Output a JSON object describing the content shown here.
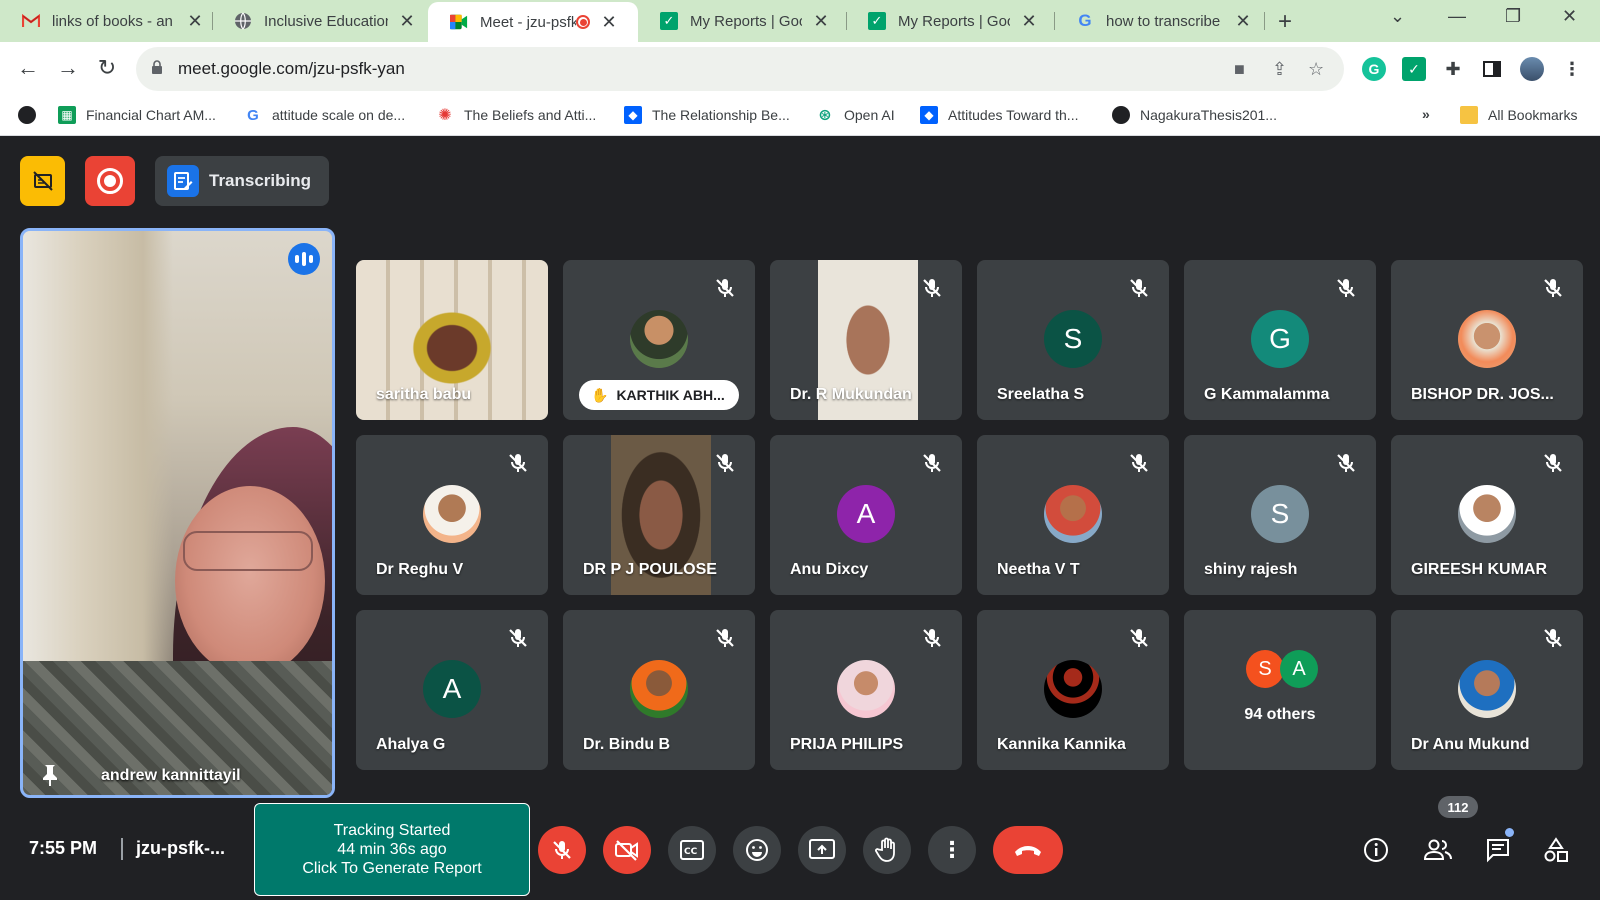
{
  "browser": {
    "tabs": [
      {
        "title": "links of books - an",
        "icon": "gmail-icon"
      },
      {
        "title": "Inclusive Education",
        "icon": "globe-icon"
      },
      {
        "title": "Meet - jzu-psfk",
        "icon": "meet-icon",
        "recording": true
      },
      {
        "title": "My Reports | Goog",
        "icon": "check-icon"
      },
      {
        "title": "My Reports | Goog",
        "icon": "check-icon"
      },
      {
        "title": "how to transcribe t",
        "icon": "google-icon"
      }
    ],
    "url": "meet.google.com/jzu-psfk-yan",
    "bookmarks": [
      {
        "label": "Financial Chart AM...",
        "icon": "sheets-icon"
      },
      {
        "label": "attitude scale on de...",
        "icon": "google-icon"
      },
      {
        "label": "The Beliefs and Atti...",
        "icon": "flower-icon"
      },
      {
        "label": "The Relationship Be...",
        "icon": "dropbox-icon"
      },
      {
        "label": "Open AI",
        "icon": "openai-icon"
      },
      {
        "label": "Attitudes Toward th...",
        "icon": "dropbox-icon"
      },
      {
        "label": "NagakuraThesis201...",
        "icon": "globe-icon"
      }
    ],
    "overflow": "»",
    "all_bookmarks": "All Bookmarks"
  },
  "meet": {
    "transcribing_label": "Transcribing",
    "speaker": {
      "name": "andrew kannittayil"
    },
    "tiles": [
      {
        "name": "saritha babu",
        "kind": "video",
        "muted": false
      },
      {
        "name": "KARTHIK ABH...",
        "kind": "photo",
        "muted": true,
        "hand_raised": true
      },
      {
        "name": "Dr. R Mukundan",
        "kind": "video",
        "muted": true
      },
      {
        "name": "Sreelatha S",
        "kind": "letter",
        "letter": "S",
        "color": "#0b5345",
        "muted": true
      },
      {
        "name": "G Kammalamma",
        "kind": "letter",
        "letter": "G",
        "color": "#138a7a",
        "muted": true
      },
      {
        "name": "BISHOP DR. JOS...",
        "kind": "photo",
        "muted": true
      },
      {
        "name": "Dr Reghu V",
        "kind": "photo",
        "muted": true
      },
      {
        "name": "DR P J POULOSE",
        "kind": "video",
        "muted": true
      },
      {
        "name": "Anu Dixcy",
        "kind": "letter",
        "letter": "A",
        "color": "#8e24aa",
        "muted": true
      },
      {
        "name": "Neetha V T",
        "kind": "photo",
        "muted": true
      },
      {
        "name": "shiny rajesh",
        "kind": "letter",
        "letter": "S",
        "color": "#78909c",
        "muted": true
      },
      {
        "name": "GIREESH KUMAR",
        "kind": "photo",
        "muted": true
      },
      {
        "name": "Ahalya G",
        "kind": "letter",
        "letter": "A",
        "color": "#0b5345",
        "muted": true
      },
      {
        "name": "Dr. Bindu B",
        "kind": "photo",
        "muted": true
      },
      {
        "name": "PRIJA PHILIPS",
        "kind": "photo",
        "muted": true
      },
      {
        "name": "Kannika Kannika",
        "kind": "photo",
        "muted": true
      },
      {
        "name": "94 others",
        "kind": "others",
        "letters": [
          "S",
          "A"
        ],
        "colors": [
          "#f4511e",
          "#0f9d58"
        ]
      },
      {
        "name": "Dr Anu Mukund",
        "kind": "photo",
        "muted": true
      }
    ],
    "clock": "7:55 PM",
    "meeting_code": "jzu-psfk-...",
    "tracker": {
      "line1": "Tracking Started",
      "line2": "44 min 36s ago",
      "line3": "Click To Generate Report"
    },
    "participant_count": "112"
  },
  "colors": {
    "meet_bg": "#202124",
    "tile_bg": "#3c4043",
    "danger": "#ea4335",
    "tracker": "#00796b",
    "tab_strip": "#cfe8c9"
  }
}
